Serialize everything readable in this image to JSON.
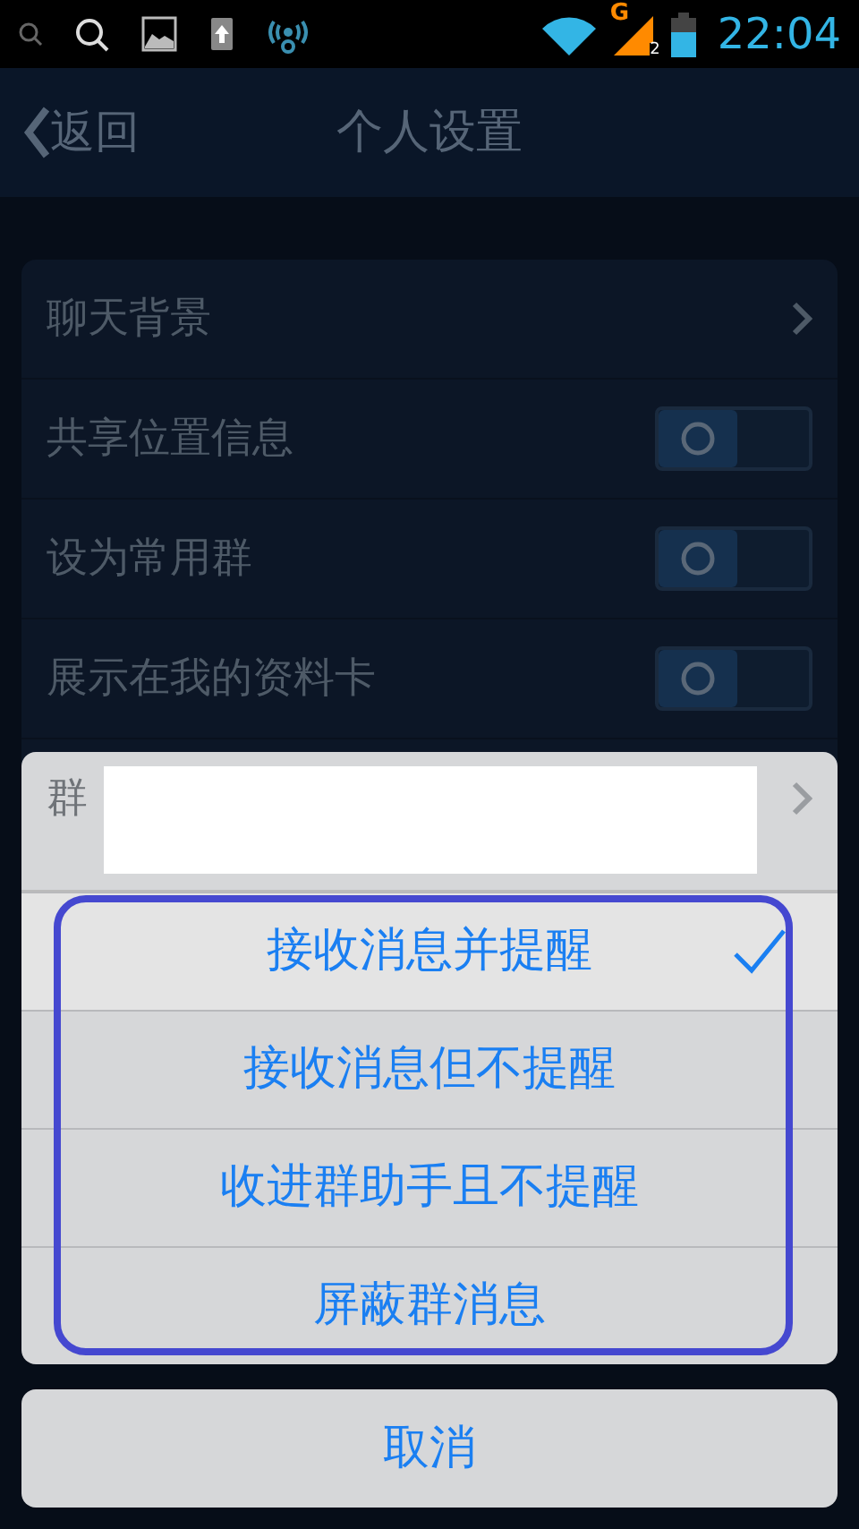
{
  "status_bar": {
    "time": "22:04",
    "network": "G",
    "sim_slot": "2"
  },
  "header": {
    "back": "返回",
    "title": "个人设置"
  },
  "settings": [
    {
      "kind": "link",
      "label": "聊天背景"
    },
    {
      "kind": "toggle",
      "label": "共享位置信息",
      "on": false
    },
    {
      "kind": "toggle",
      "label": "设为常用群",
      "on": false
    },
    {
      "kind": "toggle",
      "label": "展示在我的资料卡",
      "on": false
    },
    {
      "kind": "link",
      "label": "群"
    }
  ],
  "action_sheet": {
    "options": [
      {
        "label": "接收消息并提醒",
        "selected": true
      },
      {
        "label": "接收消息但不提醒",
        "selected": false
      },
      {
        "label": "收进群助手且不提醒",
        "selected": false
      },
      {
        "label": "屏蔽群消息",
        "selected": false
      }
    ],
    "cancel": "取消"
  }
}
